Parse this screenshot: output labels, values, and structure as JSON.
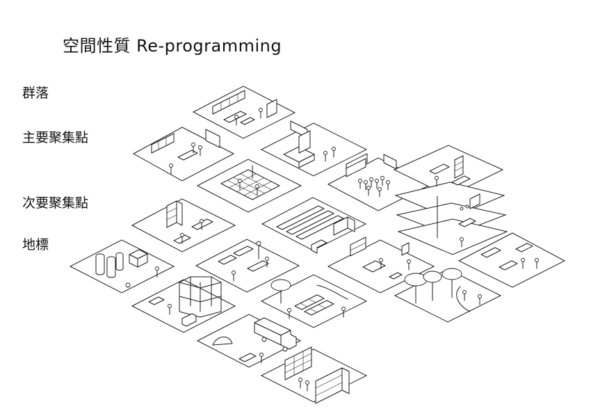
{
  "title": "空間性質 Re-programming",
  "labels": [
    "群落",
    "主要聚集點",
    "次要聚集點",
    "地標"
  ]
}
